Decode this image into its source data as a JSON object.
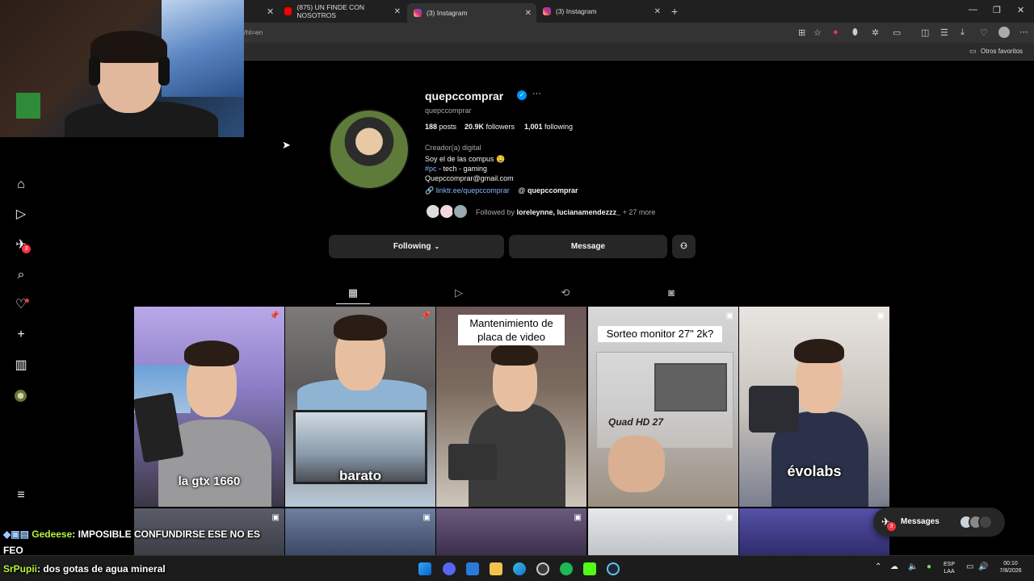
{
  "browser": {
    "tabs": [
      {
        "title": "(875) UN FINDE CON NOSOTROS"
      },
      {
        "title": "(3) Instagram"
      },
      {
        "title": "(3) Instagram"
      }
    ],
    "url_fragment": "/hl=en",
    "favorites_label": "Otros favoritos"
  },
  "sidebar": {
    "notification_count": "3"
  },
  "profile": {
    "username": "quepccomprar",
    "handle": "quepccomprar",
    "posts_count": "188",
    "posts_label": "posts",
    "followers_count": "20.9K",
    "followers_label": "followers",
    "following_count": "1,001",
    "following_label": "following",
    "category": "Creador(a) digital",
    "bio_line1": "Soy el de las compus 🤤",
    "bio_hashtag": "#pc",
    "bio_line2_rest": " - tech - gaming",
    "bio_email": "Quepccomprar@gmail.com",
    "link": "linktr.ee/quepccomprar",
    "threads": "quepccomprar",
    "followed_by_prefix": "Followed by ",
    "followed_by_names": "loreleynne, lucianamendezzz_",
    "followed_by_more": " + 27 more",
    "following_button": "Following",
    "message_button": "Message"
  },
  "posts": [
    {
      "caption": "la gtx 1660"
    },
    {
      "caption": "barato"
    },
    {
      "caption": "Mantenimiento de placa de video"
    },
    {
      "caption": "Sorteo monitor 27\" 2k?",
      "sub": "Quad HD 27"
    },
    {
      "caption": "évolabs"
    }
  ],
  "messages": {
    "label": "Messages",
    "count": "3"
  },
  "chat": [
    {
      "user": "Gedeese",
      "text": ": IMPOSIBLE CONFUNDIRSE ESE NO ES FEO"
    },
    {
      "user": "SrPupii",
      "text": ": dos gotas de agua mineral"
    }
  ],
  "tray": {
    "lang1": "ESP",
    "lang2": "LAA",
    "time": "00:10",
    "date": "7/8/2026"
  },
  "colors": {
    "accent_link": "#e0f1ff",
    "verified": "#0095f6",
    "chat_user": "#b8f53a",
    "badge": "#ff3040"
  }
}
